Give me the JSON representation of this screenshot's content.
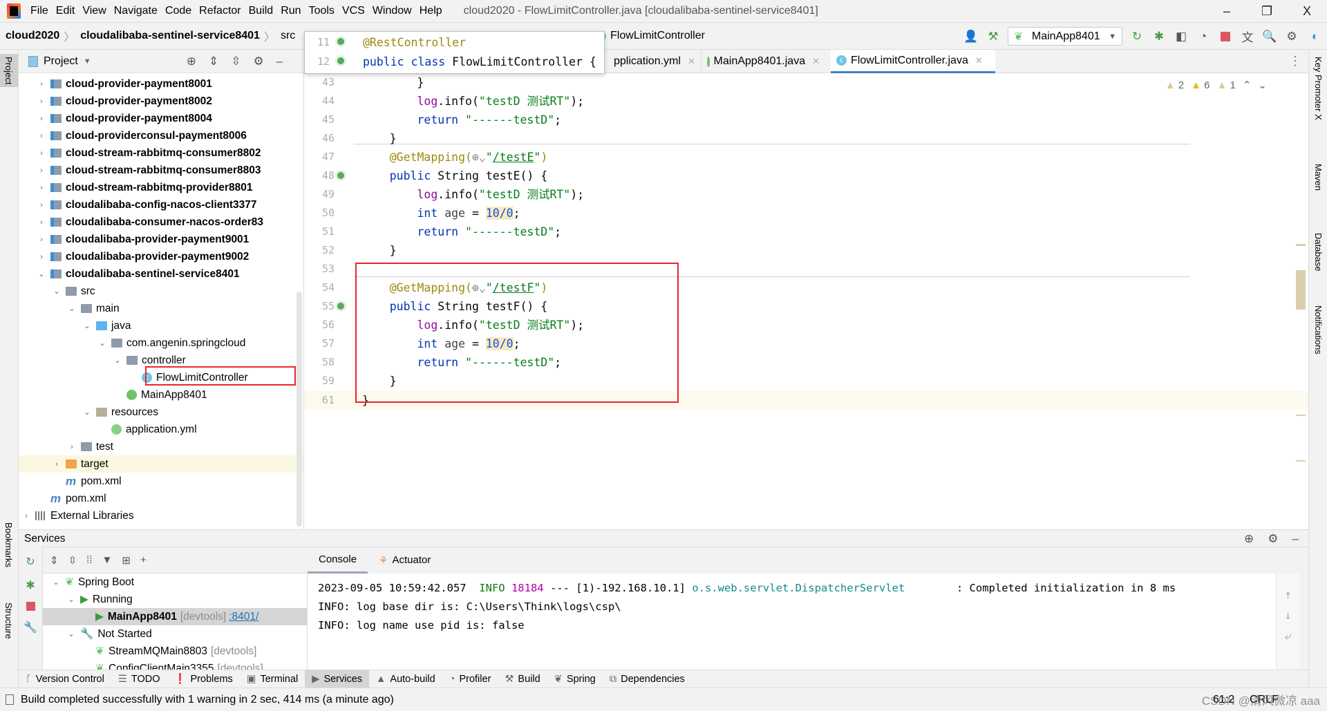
{
  "window": {
    "title": "cloud2020 - FlowLimitController.java [cloudalibaba-sentinel-service8401]",
    "menu": [
      "File",
      "Edit",
      "View",
      "Navigate",
      "Code",
      "Refactor",
      "Build",
      "Run",
      "Tools",
      "VCS",
      "Window",
      "Help"
    ],
    "controls": [
      "–",
      "❐",
      "X"
    ]
  },
  "nav": {
    "breadcrumb": [
      "cloud2020",
      "cloudalibaba-sentinel-service8401",
      "src"
    ],
    "current": "FlowLimitController",
    "run_config": "MainApp8401"
  },
  "left_strip": {
    "project": "Project",
    "bookmarks": "Bookmarks",
    "structure": "Structure"
  },
  "right_strip": {
    "items": [
      "Key Promoter X",
      "Maven",
      "Database",
      "Notifications"
    ]
  },
  "project": {
    "title": "Project",
    "rows": [
      {
        "label": "cloud-provider-payment8001",
        "level": 1,
        "icon": "mod",
        "bold": true,
        "arrow": "›"
      },
      {
        "label": "cloud-provider-payment8002",
        "level": 1,
        "icon": "mod",
        "bold": true,
        "arrow": "›"
      },
      {
        "label": "cloud-provider-payment8004",
        "level": 1,
        "icon": "mod",
        "bold": true,
        "arrow": "›"
      },
      {
        "label": "cloud-providerconsul-payment8006",
        "level": 1,
        "icon": "mod",
        "bold": true,
        "arrow": "›"
      },
      {
        "label": "cloud-stream-rabbitmq-consumer8802",
        "level": 1,
        "icon": "mod",
        "bold": true,
        "arrow": "›"
      },
      {
        "label": "cloud-stream-rabbitmq-consumer8803",
        "level": 1,
        "icon": "mod",
        "bold": true,
        "arrow": "›"
      },
      {
        "label": "cloud-stream-rabbitmq-provider8801",
        "level": 1,
        "icon": "mod",
        "bold": true,
        "arrow": "›"
      },
      {
        "label": "cloudalibaba-config-nacos-client3377",
        "level": 1,
        "icon": "mod",
        "bold": true,
        "arrow": "›"
      },
      {
        "label": "cloudalibaba-consumer-nacos-order83",
        "level": 1,
        "icon": "mod",
        "bold": true,
        "arrow": "›"
      },
      {
        "label": "cloudalibaba-provider-payment9001",
        "level": 1,
        "icon": "mod",
        "bold": true,
        "arrow": "›"
      },
      {
        "label": "cloudalibaba-provider-payment9002",
        "level": 1,
        "icon": "mod",
        "bold": true,
        "arrow": "›"
      },
      {
        "label": "cloudalibaba-sentinel-service8401",
        "level": 1,
        "icon": "mod",
        "bold": true,
        "arrow": "⌄"
      },
      {
        "label": "src",
        "level": 2,
        "icon": "fold",
        "arrow": "⌄"
      },
      {
        "label": "main",
        "level": 3,
        "icon": "fold",
        "arrow": "⌄"
      },
      {
        "label": "java",
        "level": 4,
        "icon": "jav",
        "arrow": "⌄"
      },
      {
        "label": "com.angenin.springcloud",
        "level": 5,
        "icon": "fold",
        "arrow": "⌄"
      },
      {
        "label": "controller",
        "level": 6,
        "icon": "fold",
        "arrow": "⌄"
      },
      {
        "label": "FlowLimitController",
        "level": 7,
        "icon": "cls",
        "arrow": ""
      },
      {
        "label": "MainApp8401",
        "level": 6,
        "icon": "spr",
        "arrow": ""
      },
      {
        "label": "resources",
        "level": 4,
        "icon": "res",
        "arrow": "⌄"
      },
      {
        "label": "application.yml",
        "level": 5,
        "icon": "yml",
        "arrow": ""
      },
      {
        "label": "test",
        "level": 3,
        "icon": "fold",
        "arrow": "›"
      },
      {
        "label": "target",
        "level": 2,
        "icon": "tgt",
        "arrow": "›",
        "highlight": true
      },
      {
        "label": "pom.xml",
        "level": 2,
        "icon": "mvn",
        "arrow": ""
      },
      {
        "label": "pom.xml",
        "level": 1,
        "icon": "mvn",
        "arrow": ""
      },
      {
        "label": "External Libraries",
        "level": 0,
        "icon": "lib",
        "arrow": "›"
      }
    ]
  },
  "editor": {
    "tabs": [
      {
        "label": "pplication.yml"
      },
      {
        "label": "MainApp8401.java"
      },
      {
        "label": "FlowLimitController.java",
        "active": true
      }
    ],
    "inspections": {
      "weak_warnings": "2",
      "warnings": "6",
      "typos": "1"
    },
    "sticky": [
      {
        "ln": "11",
        "tokens": [
          [
            "@RestController",
            "ann"
          ]
        ]
      },
      {
        "ln": "12",
        "tokens": [
          [
            "public class ",
            "kw"
          ],
          [
            "FlowLimitController ",
            "plain"
          ],
          [
            "{",
            "plain"
          ]
        ]
      }
    ],
    "lines": [
      {
        "ln": "43",
        "tokens": [
          [
            "        }",
            "plain"
          ]
        ]
      },
      {
        "ln": "44",
        "tokens": [
          [
            "        ",
            "plain"
          ],
          [
            "log",
            "fld"
          ],
          [
            ".info(",
            "plain"
          ],
          [
            "\"testD 测试RT\"",
            "str"
          ],
          [
            ");",
            "plain"
          ]
        ]
      },
      {
        "ln": "45",
        "tokens": [
          [
            "        ",
            "plain"
          ],
          [
            "return ",
            "kw"
          ],
          [
            "\"------testD\"",
            "str"
          ],
          [
            ";",
            "plain"
          ]
        ]
      },
      {
        "ln": "46",
        "tokens": [
          [
            "    }",
            "plain"
          ]
        ]
      },
      {
        "ln": "47",
        "tokens": [
          [
            "    ",
            "plain"
          ],
          [
            "@GetMapping(",
            "ann"
          ],
          [
            "⊕⌄",
            "glob"
          ],
          [
            "\"",
            "str"
          ],
          [
            "/testE",
            "url"
          ],
          [
            "\"",
            "str"
          ],
          [
            ")",
            "ann"
          ]
        ]
      },
      {
        "ln": "48",
        "tokens": [
          [
            "    ",
            "plain"
          ],
          [
            "public ",
            "kw"
          ],
          [
            "String testE() {",
            "plain"
          ]
        ],
        "gutter": true
      },
      {
        "ln": "49",
        "tokens": [
          [
            "        ",
            "plain"
          ],
          [
            "log",
            "fld"
          ],
          [
            ".info(",
            "plain"
          ],
          [
            "\"testD 测试RT\"",
            "str"
          ],
          [
            ");",
            "plain"
          ]
        ]
      },
      {
        "ln": "50",
        "tokens": [
          [
            "        ",
            "plain"
          ],
          [
            "int ",
            "kw"
          ],
          [
            "age",
            "var"
          ],
          [
            " = ",
            "plain"
          ],
          [
            "10/0",
            "num"
          ],
          [
            ";",
            "plain"
          ]
        ]
      },
      {
        "ln": "51",
        "tokens": [
          [
            "        ",
            "plain"
          ],
          [
            "return ",
            "kw"
          ],
          [
            "\"------testD\"",
            "str"
          ],
          [
            ";",
            "plain"
          ]
        ]
      },
      {
        "ln": "52",
        "tokens": [
          [
            "    }",
            "plain"
          ]
        ]
      },
      {
        "ln": "53",
        "tokens": []
      },
      {
        "ln": "54",
        "tokens": [
          [
            "    ",
            "plain"
          ],
          [
            "@GetMapping(",
            "ann"
          ],
          [
            "⊕⌄",
            "glob"
          ],
          [
            "\"",
            "str"
          ],
          [
            "/testF",
            "url"
          ],
          [
            "\"",
            "str"
          ],
          [
            ")",
            "ann"
          ]
        ]
      },
      {
        "ln": "55",
        "tokens": [
          [
            "    ",
            "plain"
          ],
          [
            "public ",
            "kw"
          ],
          [
            "String testF() {",
            "plain"
          ]
        ],
        "gutter": true
      },
      {
        "ln": "56",
        "tokens": [
          [
            "        ",
            "plain"
          ],
          [
            "log",
            "fld"
          ],
          [
            ".info(",
            "plain"
          ],
          [
            "\"testD 测试RT\"",
            "str"
          ],
          [
            ");",
            "plain"
          ]
        ]
      },
      {
        "ln": "57",
        "tokens": [
          [
            "        ",
            "plain"
          ],
          [
            "int ",
            "kw"
          ],
          [
            "age",
            "var"
          ],
          [
            " = ",
            "plain"
          ],
          [
            "10/0",
            "num"
          ],
          [
            ";",
            "plain"
          ]
        ]
      },
      {
        "ln": "58",
        "tokens": [
          [
            "        ",
            "plain"
          ],
          [
            "return ",
            "kw"
          ],
          [
            "\"------testD\"",
            "str"
          ],
          [
            ";",
            "plain"
          ]
        ]
      },
      {
        "ln": "59",
        "tokens": [
          [
            "    }",
            "plain"
          ]
        ]
      },
      {
        "ln": "61",
        "tokens": [
          [
            "}",
            "plain"
          ]
        ],
        "current": true
      }
    ]
  },
  "services": {
    "title": "Services",
    "tree": [
      {
        "label": "Spring Boot",
        "level": 0,
        "arrow": "⌄",
        "icon": "spring"
      },
      {
        "label": "Running",
        "level": 1,
        "arrow": "⌄",
        "icon": "run"
      },
      {
        "label": "MainApp8401",
        "extra": "[devtools]",
        "link": ":8401/",
        "level": 2,
        "icon": "run",
        "selected": true
      },
      {
        "label": "Not Started",
        "level": 1,
        "arrow": "⌄",
        "icon": "wrench"
      },
      {
        "label": "StreamMQMain8803",
        "extra": "[devtools]",
        "level": 2,
        "icon": "spring"
      },
      {
        "label": "ConfigClientMain3355",
        "extra": "[devtools]",
        "level": 2,
        "icon": "spring"
      }
    ],
    "tabs": [
      "Console",
      "Actuator"
    ],
    "console": [
      {
        "parts": [
          [
            "2023-09-05 10:59:42.057  ",
            ""
          ],
          [
            "INFO ",
            "cinfo"
          ],
          [
            "18184",
            "cpid"
          ],
          [
            " --- [1)-192.168.10.1] ",
            ""
          ],
          [
            "o.s.web.servlet.DispatcherServlet",
            "ccls"
          ],
          [
            "        : Completed initialization in 8 ms",
            ""
          ]
        ]
      },
      {
        "parts": [
          [
            "INFO: log base dir is: C:\\Users\\Think\\logs\\csp\\",
            ""
          ]
        ]
      },
      {
        "parts": [
          [
            "INFO: log name use pid is: false",
            ""
          ]
        ]
      }
    ]
  },
  "bottom_tabs": [
    {
      "label": "Version Control",
      "icon": "ᚴ"
    },
    {
      "label": "TODO",
      "icon": "☰"
    },
    {
      "label": "Problems",
      "icon": "❗"
    },
    {
      "label": "Terminal",
      "icon": "▣"
    },
    {
      "label": "Services",
      "icon": "▶",
      "active": true
    },
    {
      "label": "Auto-build",
      "icon": "▲"
    },
    {
      "label": "Profiler",
      "icon": "◔"
    },
    {
      "label": "Build",
      "icon": "⚒"
    },
    {
      "label": "Spring",
      "icon": "❦"
    },
    {
      "label": "Dependencies",
      "icon": "⧉"
    }
  ],
  "status": {
    "message": "Build completed successfully with 1 warning in 2 sec, 414 ms (a minute ago)",
    "position": "61:2",
    "line_sep": "CRLF",
    "watermark": "CSDN @清风微凉 aaa"
  }
}
